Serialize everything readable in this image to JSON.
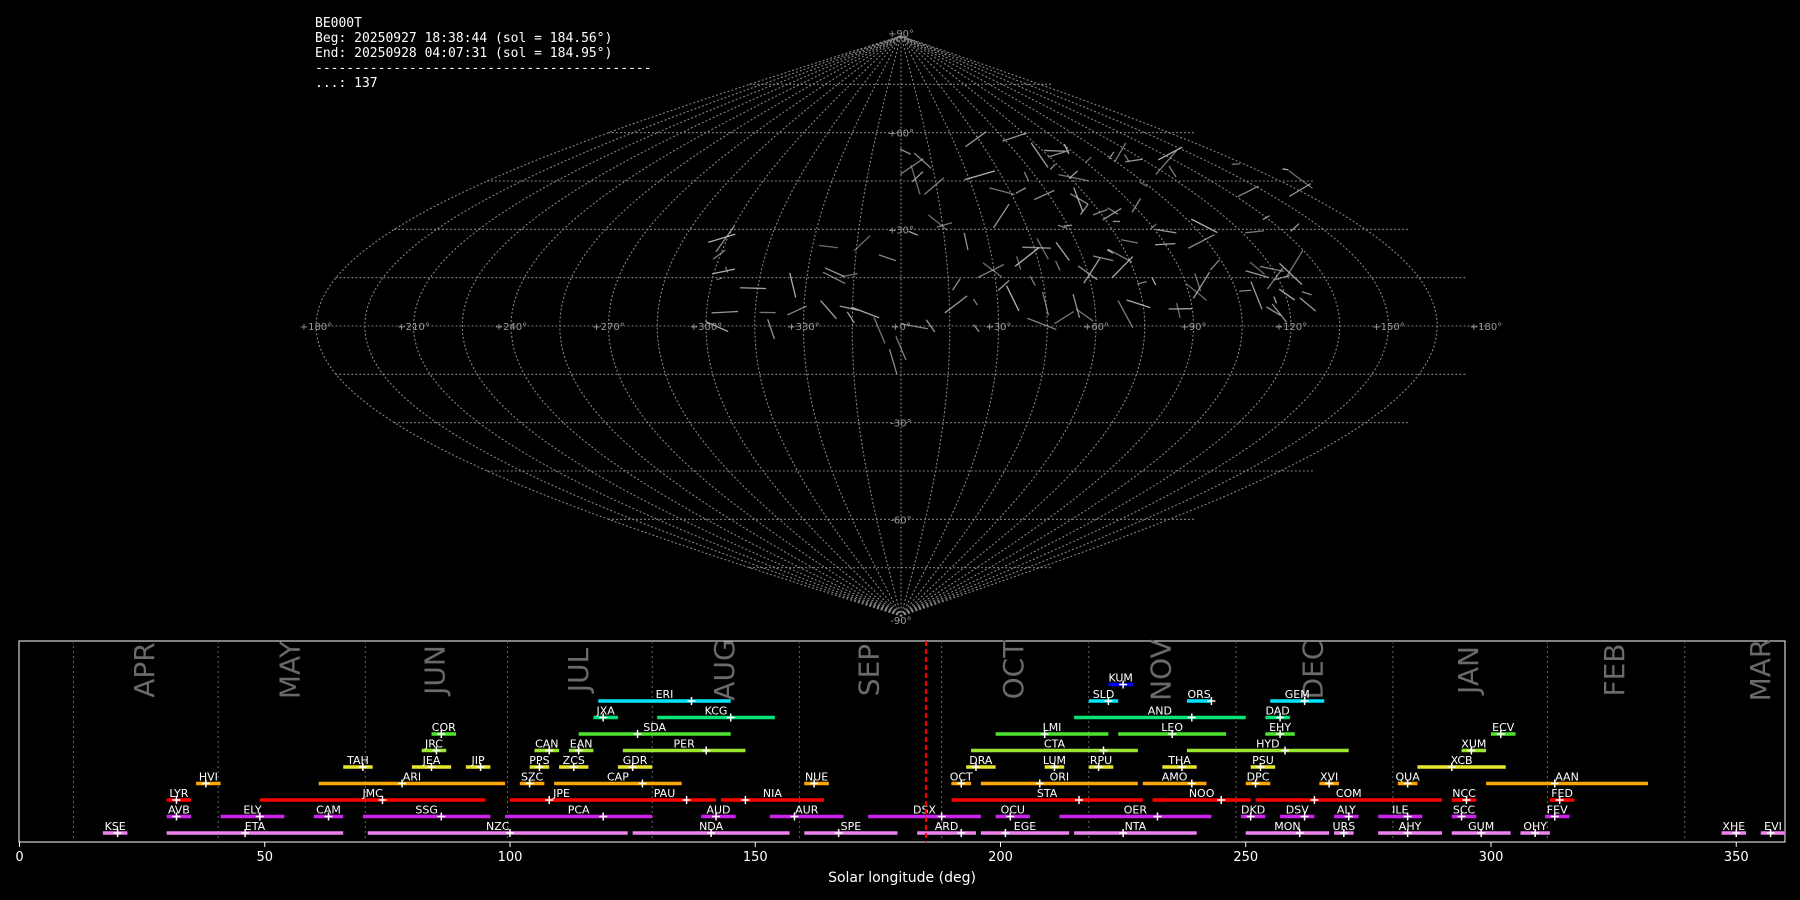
{
  "info": {
    "station": "BE000T",
    "begin": "Beg: 20250927 18:38:44 (sol = 184.56°)",
    "end": "End: 20250928 04:07:31 (sol = 184.95°)",
    "divider": "-------------------------------------------",
    "count": "...: 137"
  },
  "colors": {
    "background": "#000000",
    "grid": "#8a8a8a",
    "meteor": "#bdbdbd",
    "current_sol": "#ff0000"
  },
  "sky_map": {
    "projection": "sinusoidal",
    "lon_labels": [
      "+180°",
      "+150°",
      "+120°",
      "+90°",
      "+60°",
      "+30°",
      "+0°",
      "+330°",
      "+300°",
      "+270°",
      "+240°",
      "+210°",
      "+180°"
    ],
    "lat_labels": [
      "+90°",
      "+60°",
      "+30°",
      "-30°",
      "-60°",
      "-90°"
    ]
  },
  "chart_data": {
    "type": "gantt",
    "xlabel": "Solar longitude (deg)",
    "xlim": [
      0,
      360
    ],
    "xticks": [
      0,
      50,
      100,
      150,
      200,
      250,
      300,
      350
    ],
    "current_sol": 184.8,
    "months": [
      {
        "name": "APR",
        "start": 11.0,
        "end": 40.5
      },
      {
        "name": "MAY",
        "start": 40.5,
        "end": 70.5
      },
      {
        "name": "JUN",
        "start": 70.5,
        "end": 99.5
      },
      {
        "name": "JUL",
        "start": 99.5,
        "end": 129.0
      },
      {
        "name": "AUG",
        "start": 129.0,
        "end": 159.0
      },
      {
        "name": "SEP",
        "start": 159.0,
        "end": 188.0
      },
      {
        "name": "OCT",
        "start": 188.0,
        "end": 218.0
      },
      {
        "name": "NOV",
        "start": 218.0,
        "end": 248.0
      },
      {
        "name": "DEC",
        "start": 248.0,
        "end": 280.0
      },
      {
        "name": "JAN",
        "start": 280.0,
        "end": 311.5
      },
      {
        "name": "FEB",
        "start": 311.5,
        "end": 339.5
      },
      {
        "name": "MAR",
        "start": 339.5,
        "end": 371.0
      }
    ],
    "showers": [
      {
        "code": "KUM",
        "start": 222,
        "end": 227,
        "peak": 225,
        "row": 11,
        "color": "#0000ff"
      },
      {
        "code": "ERI",
        "start": 118,
        "end": 145,
        "peak": 137,
        "row": 10,
        "color": "#00e5ff"
      },
      {
        "code": "SLD",
        "start": 218,
        "end": 224,
        "peak": 222,
        "row": 10,
        "color": "#00e5ff"
      },
      {
        "code": "ORS",
        "start": 238,
        "end": 243,
        "peak": 243,
        "row": 10,
        "color": "#00e5ff"
      },
      {
        "code": "GEM",
        "start": 255,
        "end": 266,
        "peak": 262,
        "row": 10,
        "color": "#00e5ff"
      },
      {
        "code": "JXA",
        "start": 117,
        "end": 122,
        "peak": 119,
        "row": 9,
        "color": "#00e57a"
      },
      {
        "code": "KCG",
        "start": 130,
        "end": 154,
        "peak": 145,
        "row": 9,
        "color": "#00e57a"
      },
      {
        "code": "AND",
        "start": 215,
        "end": 250,
        "peak": 239,
        "row": 9,
        "color": "#00e57a"
      },
      {
        "code": "DAD",
        "start": 254,
        "end": 259,
        "peak": 257,
        "row": 9,
        "color": "#00e57a"
      },
      {
        "code": "COR",
        "start": 84,
        "end": 89,
        "peak": 86,
        "row": 8,
        "color": "#4ce62e"
      },
      {
        "code": "SDA",
        "start": 114,
        "end": 145,
        "peak": 126,
        "row": 8,
        "color": "#4ce62e"
      },
      {
        "code": "LMI",
        "start": 199,
        "end": 222,
        "peak": 209,
        "row": 8,
        "color": "#4ce62e"
      },
      {
        "code": "LEO",
        "start": 224,
        "end": 246,
        "peak": 235,
        "row": 8,
        "color": "#4ce62e"
      },
      {
        "code": "EHY",
        "start": 254,
        "end": 260,
        "peak": 257,
        "row": 8,
        "color": "#4ce62e"
      },
      {
        "code": "ECV",
        "start": 300,
        "end": 305,
        "peak": 302,
        "row": 8,
        "color": "#4ce62e"
      },
      {
        "code": "JRC",
        "start": 82,
        "end": 87,
        "peak": 85,
        "row": 7,
        "color": "#99e62e"
      },
      {
        "code": "CAN",
        "start": 105,
        "end": 110,
        "peak": 108,
        "row": 7,
        "color": "#99e62e"
      },
      {
        "code": "EAN",
        "start": 112,
        "end": 117,
        "peak": 114,
        "row": 7,
        "color": "#99e62e"
      },
      {
        "code": "PER",
        "start": 123,
        "end": 148,
        "peak": 140,
        "row": 7,
        "color": "#99e62e"
      },
      {
        "code": "CTA",
        "start": 194,
        "end": 228,
        "peak": 221,
        "row": 7,
        "color": "#99e62e"
      },
      {
        "code": "HYD",
        "start": 238,
        "end": 271,
        "peak": 258,
        "row": 7,
        "color": "#99e62e"
      },
      {
        "code": "XUM",
        "start": 294,
        "end": 299,
        "peak": 296,
        "row": 7,
        "color": "#99e62e"
      },
      {
        "code": "TAH",
        "start": 66,
        "end": 72,
        "peak": 70,
        "row": 6,
        "color": "#e6e62e"
      },
      {
        "code": "JEA",
        "start": 80,
        "end": 88,
        "peak": 84,
        "row": 6,
        "color": "#e6e62e"
      },
      {
        "code": "JIP",
        "start": 91,
        "end": 96,
        "peak": 94,
        "row": 6,
        "color": "#e6e62e"
      },
      {
        "code": "PPS",
        "start": 104,
        "end": 108,
        "peak": 106,
        "row": 6,
        "color": "#e6e62e"
      },
      {
        "code": "ZCS",
        "start": 110,
        "end": 116,
        "peak": 113,
        "row": 6,
        "color": "#e6e62e"
      },
      {
        "code": "GDR",
        "start": 122,
        "end": 129,
        "peak": 125,
        "row": 6,
        "color": "#e6e62e"
      },
      {
        "code": "DRA",
        "start": 193,
        "end": 199,
        "peak": 195,
        "row": 6,
        "color": "#e6e62e"
      },
      {
        "code": "LUM",
        "start": 209,
        "end": 213,
        "peak": 211,
        "row": 6,
        "color": "#e6e62e"
      },
      {
        "code": "RPU",
        "start": 218,
        "end": 223,
        "peak": 220,
        "row": 6,
        "color": "#e6e62e"
      },
      {
        "code": "THA",
        "start": 233,
        "end": 240,
        "peak": 237,
        "row": 6,
        "color": "#e6e62e"
      },
      {
        "code": "PSU",
        "start": 251,
        "end": 256,
        "peak": 253,
        "row": 6,
        "color": "#e6e62e"
      },
      {
        "code": "XCB",
        "start": 285,
        "end": 303,
        "peak": 292,
        "row": 6,
        "color": "#e6e62e"
      },
      {
        "code": "HVI",
        "start": 36,
        "end": 41,
        "peak": 38,
        "row": 5,
        "color": "#ffa500"
      },
      {
        "code": "ARI",
        "start": 61,
        "end": 99,
        "peak": 78,
        "row": 5,
        "color": "#ffa500"
      },
      {
        "code": "SZC",
        "start": 102,
        "end": 107,
        "peak": 104,
        "row": 5,
        "color": "#ffa500"
      },
      {
        "code": "CAP",
        "start": 109,
        "end": 135,
        "peak": 127,
        "row": 5,
        "color": "#ffa500"
      },
      {
        "code": "NUE",
        "start": 160,
        "end": 165,
        "peak": 162,
        "row": 5,
        "color": "#ffa500"
      },
      {
        "code": "OCT",
        "start": 190,
        "end": 194,
        "peak": 192,
        "row": 5,
        "color": "#ffa500"
      },
      {
        "code": "ORI",
        "start": 196,
        "end": 228,
        "peak": 208,
        "row": 5,
        "color": "#ffa500"
      },
      {
        "code": "AMO",
        "start": 229,
        "end": 242,
        "peak": 239,
        "row": 5,
        "color": "#ffa500"
      },
      {
        "code": "DPC",
        "start": 250,
        "end": 255,
        "peak": 252,
        "row": 5,
        "color": "#ffa500"
      },
      {
        "code": "XVI",
        "start": 265,
        "end": 269,
        "peak": 267,
        "row": 5,
        "color": "#ffa500"
      },
      {
        "code": "QUA",
        "start": 281,
        "end": 285,
        "peak": 283,
        "row": 5,
        "color": "#ffa500"
      },
      {
        "code": "AAN",
        "start": 299,
        "end": 332,
        "peak": 313,
        "row": 5,
        "color": "#ffa500"
      },
      {
        "code": "LYR",
        "start": 30,
        "end": 35,
        "peak": 32,
        "row": 4,
        "color": "#ff0000"
      },
      {
        "code": "JMC",
        "start": 49,
        "end": 95,
        "peak": 74,
        "row": 4,
        "color": "#ff0000"
      },
      {
        "code": "JPE",
        "start": 100,
        "end": 121,
        "peak": 108,
        "row": 4,
        "color": "#ff0000"
      },
      {
        "code": "PAU",
        "start": 121,
        "end": 142,
        "peak": 136,
        "row": 4,
        "color": "#ff0000"
      },
      {
        "code": "NIA",
        "start": 143,
        "end": 164,
        "peak": 148,
        "row": 4,
        "color": "#ff0000"
      },
      {
        "code": "STA",
        "start": 190,
        "end": 229,
        "peak": 216,
        "row": 4,
        "color": "#ff0000"
      },
      {
        "code": "NOO",
        "start": 231,
        "end": 251,
        "peak": 245,
        "row": 4,
        "color": "#ff0000"
      },
      {
        "code": "COM",
        "start": 252,
        "end": 290,
        "peak": 264,
        "row": 4,
        "color": "#ff0000"
      },
      {
        "code": "NCC",
        "start": 292,
        "end": 297,
        "peak": 295,
        "row": 4,
        "color": "#ff0000"
      },
      {
        "code": "FED",
        "start": 312,
        "end": 317,
        "peak": 314,
        "row": 4,
        "color": "#ff0000"
      },
      {
        "code": "AVB",
        "start": 30,
        "end": 35,
        "peak": 32,
        "row": 3,
        "color": "#cc22ee"
      },
      {
        "code": "ELY",
        "start": 41,
        "end": 54,
        "peak": 49,
        "row": 3,
        "color": "#cc22ee"
      },
      {
        "code": "CAM",
        "start": 60,
        "end": 66,
        "peak": 63,
        "row": 3,
        "color": "#cc22ee"
      },
      {
        "code": "SSG",
        "start": 70,
        "end": 96,
        "peak": 86,
        "row": 3,
        "color": "#cc22ee"
      },
      {
        "code": "PCA",
        "start": 99,
        "end": 129,
        "peak": 119,
        "row": 3,
        "color": "#cc22ee"
      },
      {
        "code": "AUD",
        "start": 139,
        "end": 146,
        "peak": 142,
        "row": 3,
        "color": "#cc22ee"
      },
      {
        "code": "AUR",
        "start": 153,
        "end": 168,
        "peak": 158,
        "row": 3,
        "color": "#cc22ee"
      },
      {
        "code": "DSX",
        "start": 173,
        "end": 196,
        "peak": 188,
        "row": 3,
        "color": "#cc22ee"
      },
      {
        "code": "OCU",
        "start": 199,
        "end": 206,
        "peak": 202,
        "row": 3,
        "color": "#cc22ee"
      },
      {
        "code": "OER",
        "start": 212,
        "end": 243,
        "peak": 232,
        "row": 3,
        "color": "#cc22ee"
      },
      {
        "code": "DKD",
        "start": 249,
        "end": 254,
        "peak": 251,
        "row": 3,
        "color": "#cc22ee"
      },
      {
        "code": "DSV",
        "start": 257,
        "end": 264,
        "peak": 262,
        "row": 3,
        "color": "#cc22ee"
      },
      {
        "code": "ALY",
        "start": 268,
        "end": 273,
        "peak": 271,
        "row": 3,
        "color": "#cc22ee"
      },
      {
        "code": "ILE",
        "start": 277,
        "end": 286,
        "peak": 283,
        "row": 3,
        "color": "#cc22ee"
      },
      {
        "code": "SCC",
        "start": 292,
        "end": 297,
        "peak": 294,
        "row": 3,
        "color": "#cc22ee"
      },
      {
        "code": "FEV",
        "start": 311,
        "end": 316,
        "peak": 313,
        "row": 3,
        "color": "#cc22ee"
      },
      {
        "code": "KSE",
        "start": 17,
        "end": 22,
        "peak": 20,
        "row": 2,
        "color": "#ee82ee"
      },
      {
        "code": "ETA",
        "start": 30,
        "end": 66,
        "peak": 46,
        "row": 2,
        "color": "#ee82ee"
      },
      {
        "code": "NZC",
        "start": 71,
        "end": 124,
        "peak": 100,
        "row": 2,
        "color": "#ee82ee"
      },
      {
        "code": "NDA",
        "start": 125,
        "end": 157,
        "peak": 141,
        "row": 2,
        "color": "#ee82ee"
      },
      {
        "code": "SPE",
        "start": 160,
        "end": 179,
        "peak": 167,
        "row": 2,
        "color": "#ee82ee"
      },
      {
        "code": "ARD",
        "start": 183,
        "end": 195,
        "peak": 192,
        "row": 2,
        "color": "#ee82ee"
      },
      {
        "code": "EGE",
        "start": 196,
        "end": 214,
        "peak": 201,
        "row": 2,
        "color": "#ee82ee"
      },
      {
        "code": "NTA",
        "start": 215,
        "end": 240,
        "peak": 225,
        "row": 2,
        "color": "#ee82ee"
      },
      {
        "code": "MON",
        "start": 250,
        "end": 267,
        "peak": 261,
        "row": 2,
        "color": "#ee82ee"
      },
      {
        "code": "URS",
        "start": 268,
        "end": 272,
        "peak": 270,
        "row": 2,
        "color": "#ee82ee"
      },
      {
        "code": "AHY",
        "start": 277,
        "end": 290,
        "peak": 283,
        "row": 2,
        "color": "#ee82ee"
      },
      {
        "code": "GUM",
        "start": 292,
        "end": 304,
        "peak": 298,
        "row": 2,
        "color": "#ee82ee"
      },
      {
        "code": "OHY",
        "start": 306,
        "end": 312,
        "peak": 309,
        "row": 2,
        "color": "#ee82ee"
      },
      {
        "code": "XHE",
        "start": 347,
        "end": 352,
        "peak": 350,
        "row": 2,
        "color": "#ee82ee"
      },
      {
        "code": "EVI",
        "start": 355,
        "end": 360,
        "peak": 357,
        "row": 2,
        "color": "#ee82ee"
      }
    ]
  }
}
